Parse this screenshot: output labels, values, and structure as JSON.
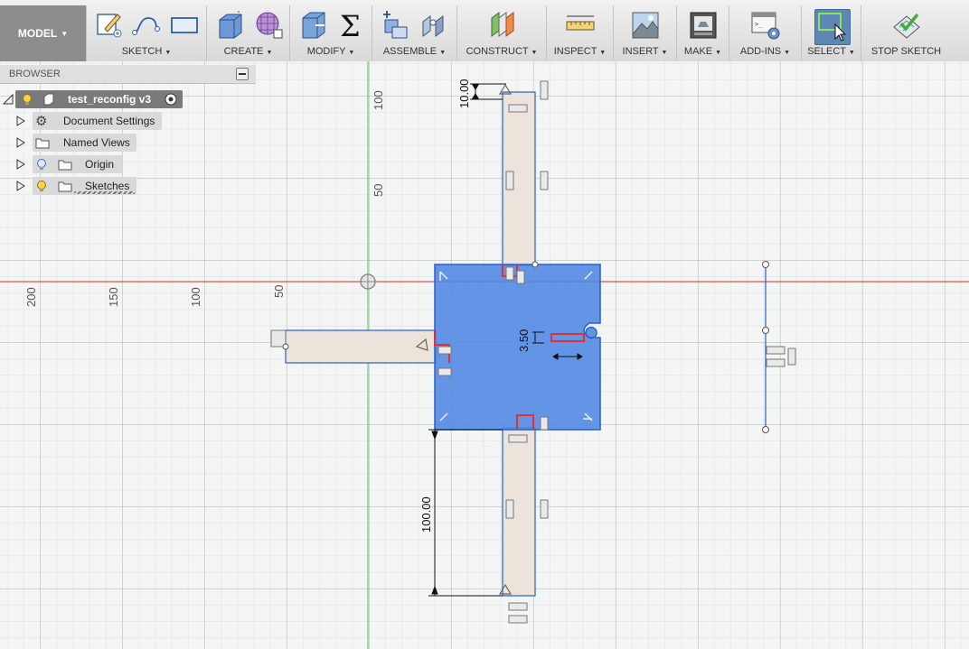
{
  "toolbar": {
    "model_label": "MODEL",
    "groups": [
      {
        "label": "SKETCH"
      },
      {
        "label": "CREATE"
      },
      {
        "label": "MODIFY"
      },
      {
        "label": "ASSEMBLE"
      },
      {
        "label": "CONSTRUCT"
      },
      {
        "label": "INSPECT"
      },
      {
        "label": "INSERT"
      },
      {
        "label": "MAKE"
      },
      {
        "label": "ADD-INS"
      },
      {
        "label": "SELECT"
      },
      {
        "label": "STOP SKETCH"
      }
    ],
    "icons": {
      "sketch": [
        "create-sketch-icon",
        "spline-icon",
        "rectangle-icon"
      ],
      "create": [
        "extrude-icon",
        "form-icon"
      ],
      "modify": [
        "press-pull-icon",
        "parameters-sigma-icon"
      ],
      "assemble": [
        "new-component-icon",
        "joint-icon"
      ],
      "construct": [
        "offset-plane-icon"
      ],
      "inspect": [
        "measure-icon"
      ],
      "insert": [
        "insert-image-icon"
      ],
      "make": [
        "3d-print-icon"
      ],
      "add_ins": [
        "scripts-icon"
      ],
      "select": [
        "select-window-icon"
      ],
      "stop_sketch": [
        "finish-sketch-icon"
      ]
    }
  },
  "browser": {
    "title": "BROWSER",
    "root": {
      "label": "test_reconfig v3"
    },
    "items": [
      {
        "label": "Document Settings",
        "icon": "gear-icon"
      },
      {
        "label": "Named Views",
        "icon": "folder-icon"
      },
      {
        "label": "Origin",
        "icon": "folder-icon"
      },
      {
        "label": "Sketches",
        "icon": "folder-icon"
      }
    ]
  },
  "canvas": {
    "ruler_vertical": [
      "100",
      "50"
    ],
    "ruler_horizontal": [
      "200",
      "150",
      "100",
      "50"
    ],
    "dimensions": {
      "top": "10.00",
      "gap": "3.50",
      "bottom": "100.00"
    },
    "colors": {
      "axis_red": "#e05555",
      "axis_green": "#6ccc6c",
      "profile_blue": "#4f86e3",
      "profile_stroke": "#2a5fc8",
      "arm_fill": "#ece4da",
      "grid": "#dcdfe0"
    }
  }
}
